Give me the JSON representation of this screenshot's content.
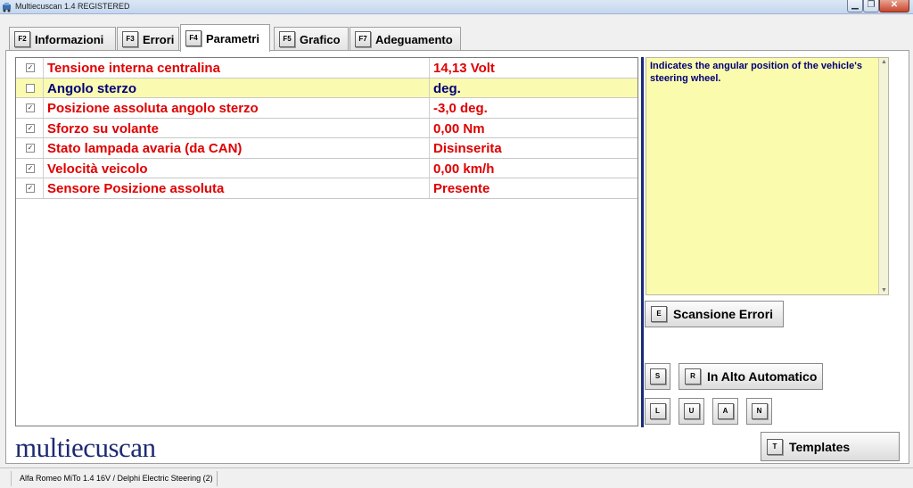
{
  "window": {
    "title": "Multiecuscan 1.4 REGISTERED",
    "controls": {
      "minimize": "▁",
      "maximize": "❐",
      "close": "✕"
    }
  },
  "tabs": [
    {
      "key": "F2",
      "label": "Informazioni"
    },
    {
      "key": "F3",
      "label": "Errori"
    },
    {
      "key": "F4",
      "label": "Parametri",
      "active": true
    },
    {
      "key": "F5",
      "label": "Grafico"
    },
    {
      "key": "F7",
      "label": "Adeguamento"
    }
  ],
  "parameters": [
    {
      "checked": true,
      "name": "Tensione interna centralina",
      "value": "14,13 Volt"
    },
    {
      "checked": false,
      "name": "Angolo sterzo",
      "value": " deg.",
      "selected": true
    },
    {
      "checked": true,
      "name": "Posizione assoluta angolo sterzo",
      "value": "-3,0 deg."
    },
    {
      "checked": true,
      "name": "Sforzo su volante",
      "value": "0,00 Nm"
    },
    {
      "checked": true,
      "name": "Stato lampada avaria (da CAN)",
      "value": "Disinserita"
    },
    {
      "checked": true,
      "name": "Velocità veicolo",
      "value": "0,00 km/h"
    },
    {
      "checked": true,
      "name": "Sensore Posizione assoluta",
      "value": "Presente"
    }
  ],
  "description": "Indicates the angular position of the vehicle's steering wheel.",
  "buttons": {
    "scan_errors": {
      "key": "E",
      "label": "Scansione Errori"
    },
    "s": {
      "key": "S"
    },
    "auto_top": {
      "key": "R",
      "label": "In Alto Automatico"
    },
    "l": {
      "key": "L"
    },
    "u": {
      "key": "U"
    },
    "a": {
      "key": "A"
    },
    "n": {
      "key": "N"
    },
    "templates": {
      "key": "T",
      "label": "Templates"
    }
  },
  "logo": "multiecuscan",
  "status": {
    "vehicle": "Alfa Romeo MiTo 1.4 16V / Delphi Electric Steering (2)"
  },
  "colors": {
    "param_text": "#e00000",
    "selected_row_bg": "#fafab0",
    "selected_text": "#00007a",
    "description_bg": "#fbfbae",
    "logo": "#1d2a73"
  },
  "icons": {
    "app": "app-icon",
    "checkbox": "checkbox-icon",
    "scroll_up": "scroll-up-icon",
    "scroll_down": "scroll-down-icon"
  }
}
